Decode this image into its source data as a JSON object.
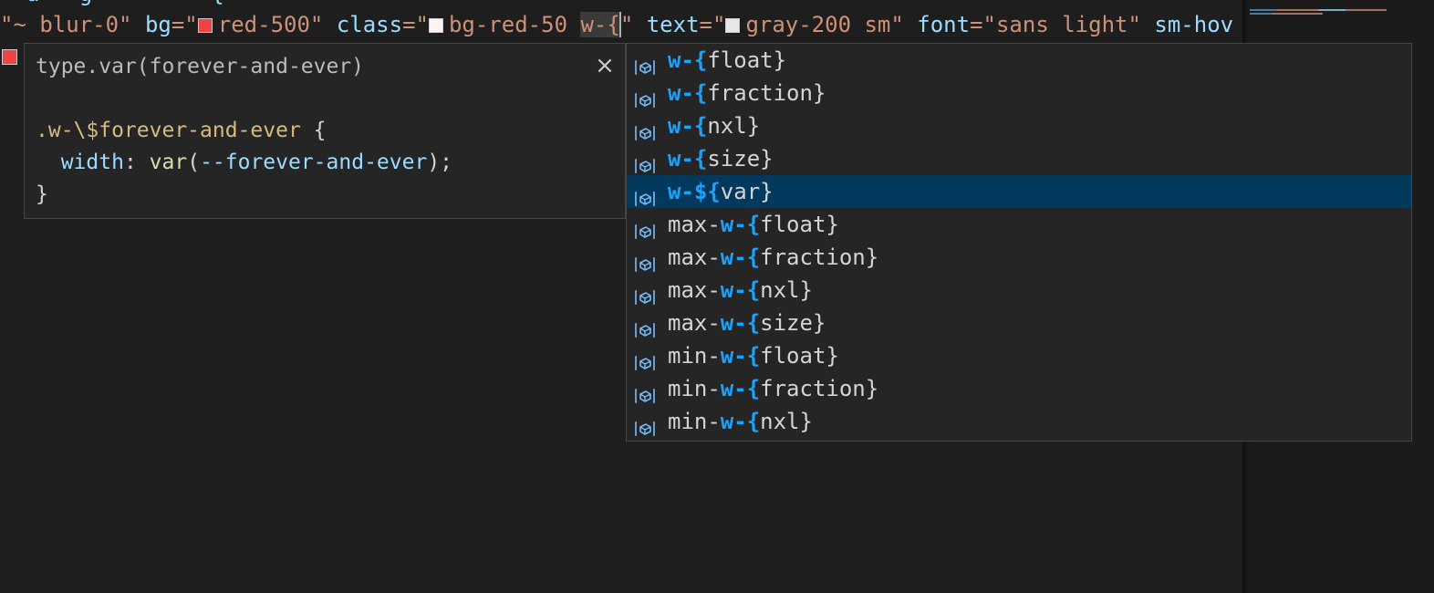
{
  "editor": {
    "previous_line_fragment": "  a   g         {",
    "tokens": {
      "t1_str": "\"~ blur-0\"",
      "t2_attr": "bg",
      "t3_eq": "=\"",
      "t4_val": "red-500\"",
      "t5_attr": "class",
      "t6_eq": "=\"",
      "t7_val": "bg-red-50",
      "t8_typed": "w-{",
      "t9_close": "\"",
      "t10_attr": "text",
      "t11_eq": "=\"",
      "t12_val": "gray-200 sm\"",
      "t13_attr": "font",
      "t14_eq": "=\"",
      "t15_val": "sans light\"",
      "t16_attr": "sm-hov"
    },
    "swatch_colors": {
      "red": "#ef4444",
      "white": "#fef2f2",
      "gray": "#e5e7eb"
    }
  },
  "hover": {
    "signature": "type.var(forever-and-ever)",
    "close_symbol": "×",
    "css": {
      "selector": ".w-\\$forever-and-ever",
      "open_brace": " {",
      "property": "width",
      "colon": ": ",
      "fn": "var",
      "paren_open": "(",
      "var_name": "--forever-and-ever",
      "paren_close": ");",
      "close_brace": "}"
    }
  },
  "suggest": {
    "active_index": 4,
    "icon": "variable-icon",
    "items": [
      {
        "pre": "",
        "match": "w-{",
        "rest": "float}"
      },
      {
        "pre": "",
        "match": "w-{",
        "rest": "fraction}"
      },
      {
        "pre": "",
        "match": "w-{",
        "rest": "nxl}"
      },
      {
        "pre": "",
        "match": "w-{",
        "rest": "size}"
      },
      {
        "pre": "",
        "match": "w-${",
        "rest": "var}"
      },
      {
        "pre": "max-",
        "match": "w-{",
        "rest": "float}"
      },
      {
        "pre": "max-",
        "match": "w-{",
        "rest": "fraction}"
      },
      {
        "pre": "max-",
        "match": "w-{",
        "rest": "nxl}"
      },
      {
        "pre": "max-",
        "match": "w-{",
        "rest": "size}"
      },
      {
        "pre": "min-",
        "match": "w-{",
        "rest": "float}"
      },
      {
        "pre": "min-",
        "match": "w-{",
        "rest": "fraction}"
      },
      {
        "pre": "min-",
        "match": "w-{",
        "rest": "nxl}"
      }
    ]
  },
  "colors": {
    "highlight": "#18a3ff",
    "active_row": "#04395e"
  }
}
